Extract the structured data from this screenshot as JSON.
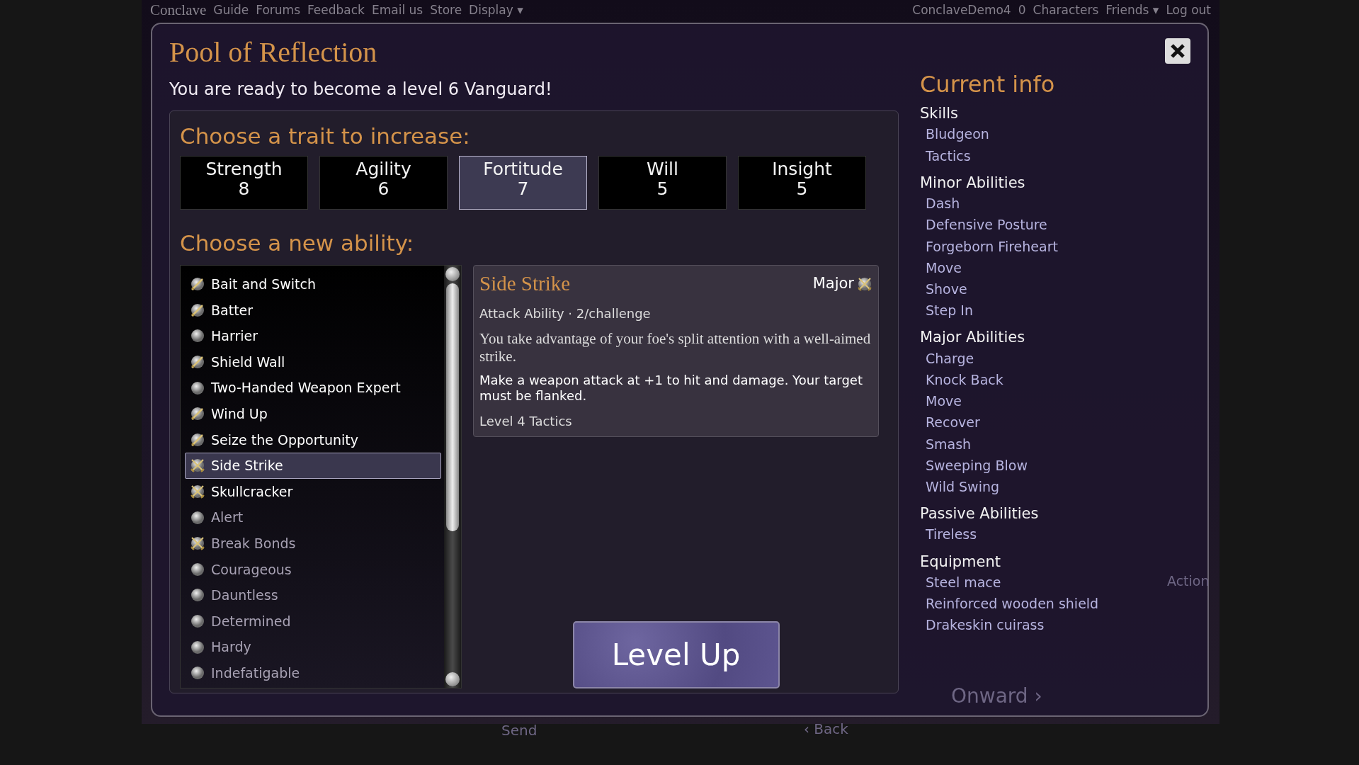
{
  "site_nav": {
    "logo": "Conclave",
    "links": [
      "Guide",
      "Forums",
      "Feedback",
      "Email us",
      "Store",
      "Display ▾"
    ],
    "user": "ConclaveDemo4",
    "count": "0",
    "user_links": [
      "Characters",
      "Friends ▾",
      "Log out"
    ]
  },
  "background_page": {
    "send": "Send",
    "back": "‹ Back",
    "onward": "Onward ›",
    "action": "Action"
  },
  "dialog": {
    "title": "Pool of Reflection",
    "message": "You are ready to become a level 6 Vanguard!",
    "trait_heading": "Choose a trait to increase:",
    "traits": [
      {
        "name": "Strength",
        "value": "8",
        "selected": false
      },
      {
        "name": "Agility",
        "value": "6",
        "selected": false
      },
      {
        "name": "Fortitude",
        "value": "7",
        "selected": true
      },
      {
        "name": "Will",
        "value": "5",
        "selected": false
      },
      {
        "name": "Insight",
        "value": "5",
        "selected": false
      }
    ],
    "ability_heading": "Choose a new ability:",
    "abilities": [
      {
        "name": "Bait and Switch",
        "kind": "minor",
        "selected": false,
        "disabled": false
      },
      {
        "name": "Batter",
        "kind": "minor",
        "selected": false,
        "disabled": false
      },
      {
        "name": "Harrier",
        "kind": "passive",
        "selected": false,
        "disabled": false
      },
      {
        "name": "Shield Wall",
        "kind": "minor",
        "selected": false,
        "disabled": false
      },
      {
        "name": "Two-Handed Weapon Expert",
        "kind": "passive",
        "selected": false,
        "disabled": false
      },
      {
        "name": "Wind Up",
        "kind": "minor",
        "selected": false,
        "disabled": false
      },
      {
        "name": "Seize the Opportunity",
        "kind": "minor",
        "selected": false,
        "disabled": false
      },
      {
        "name": "Side Strike",
        "kind": "major",
        "selected": true,
        "disabled": false
      },
      {
        "name": "Skullcracker",
        "kind": "major",
        "selected": false,
        "disabled": false
      },
      {
        "name": "Alert",
        "kind": "passive",
        "selected": false,
        "disabled": true
      },
      {
        "name": "Break Bonds",
        "kind": "major",
        "selected": false,
        "disabled": true
      },
      {
        "name": "Courageous",
        "kind": "passive",
        "selected": false,
        "disabled": true
      },
      {
        "name": "Dauntless",
        "kind": "passive",
        "selected": false,
        "disabled": true
      },
      {
        "name": "Determined",
        "kind": "passive",
        "selected": false,
        "disabled": true
      },
      {
        "name": "Hardy",
        "kind": "passive",
        "selected": false,
        "disabled": true
      },
      {
        "name": "Indefatigable",
        "kind": "passive",
        "selected": false,
        "disabled": true
      }
    ],
    "detail": {
      "name": "Side Strike",
      "tier": "Major",
      "kind": "major",
      "type_line": "Attack Ability · 2/challenge",
      "flavor": "You take advantage of your foe's split attention with a well-aimed strike.",
      "effect": "Make a weapon attack at +1 to hit and damage. Your target must be flanked.",
      "requirement": "Level 4 Tactics"
    },
    "level_up_button": "Level Up",
    "current_info": {
      "heading": "Current info",
      "groups": [
        {
          "title": "Skills",
          "items": [
            "Bludgeon",
            "Tactics"
          ]
        },
        {
          "title": "Minor Abilities",
          "items": [
            "Dash",
            "Defensive Posture",
            "Forgeborn Fireheart",
            "Move",
            "Shove",
            "Step In"
          ]
        },
        {
          "title": "Major Abilities",
          "items": [
            "Charge",
            "Knock Back",
            "Move",
            "Recover",
            "Smash",
            "Sweeping Blow",
            "Wild Swing"
          ]
        },
        {
          "title": "Passive Abilities",
          "items": [
            "Tireless"
          ]
        },
        {
          "title": "Equipment",
          "items": [
            "Steel mace",
            "Reinforced wooden shield",
            "Drakeskin cuirass"
          ]
        }
      ]
    }
  }
}
